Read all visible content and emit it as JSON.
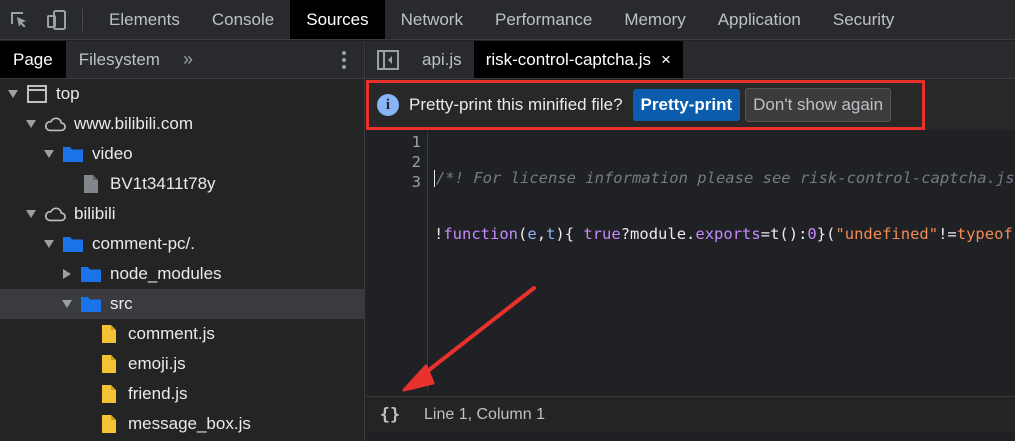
{
  "devtools": {
    "tabs": [
      "Elements",
      "Console",
      "Sources",
      "Network",
      "Performance",
      "Memory",
      "Application",
      "Security"
    ],
    "active_tab": "Sources"
  },
  "navigator": {
    "tabs": [
      "Page",
      "Filesystem"
    ],
    "active_tab": "Page",
    "more_label": "»",
    "tree": [
      {
        "label": "top",
        "depth": 0,
        "icon": "frame-icon",
        "expanded": true
      },
      {
        "label": "www.bilibili.com",
        "depth": 1,
        "icon": "cloud-icon",
        "expanded": true
      },
      {
        "label": "video",
        "depth": 2,
        "icon": "folder-icon",
        "expanded": true
      },
      {
        "label": "BV1t3411t78y",
        "depth": 3,
        "icon": "file-icon-gray",
        "expanded": null
      },
      {
        "label": "bilibili",
        "depth": 1,
        "icon": "cloud-icon",
        "expanded": true
      },
      {
        "label": "comment-pc/.",
        "depth": 2,
        "icon": "folder-icon",
        "expanded": true
      },
      {
        "label": "node_modules",
        "depth": 3,
        "icon": "folder-icon",
        "expanded": false
      },
      {
        "label": "src",
        "depth": 3,
        "icon": "folder-icon",
        "expanded": true,
        "selected": true
      },
      {
        "label": "comment.js",
        "depth": 4,
        "icon": "file-icon-yellow",
        "expanded": null
      },
      {
        "label": "emoji.js",
        "depth": 4,
        "icon": "file-icon-yellow",
        "expanded": null
      },
      {
        "label": "friend.js",
        "depth": 4,
        "icon": "file-icon-yellow",
        "expanded": null
      },
      {
        "label": "message_box.js",
        "depth": 4,
        "icon": "file-icon-yellow",
        "expanded": null
      }
    ]
  },
  "editor": {
    "file_tabs": [
      {
        "label": "api.js",
        "active": false
      },
      {
        "label": "risk-control-captcha.js",
        "active": true,
        "close": "×"
      }
    ],
    "infobar": {
      "message": "Pretty-print this minified file?",
      "primary_button": "Pretty-print",
      "secondary_button": "Don't show again"
    },
    "line_numbers": [
      "1",
      "2",
      "3"
    ],
    "code": {
      "line1": "/*! For license information please see risk-control-captcha.js.LICENSE.txt */",
      "line2_parts": [
        {
          "t": "!",
          "c": "c-plain"
        },
        {
          "t": "function",
          "c": "c-kw"
        },
        {
          "t": "(",
          "c": "c-plain"
        },
        {
          "t": "e",
          "c": "c-ident"
        },
        {
          "t": ",",
          "c": "c-plain"
        },
        {
          "t": "t",
          "c": "c-ident"
        },
        {
          "t": "){ ",
          "c": "c-plain"
        },
        {
          "t": "true",
          "c": "c-kw"
        },
        {
          "t": "?",
          "c": "c-plain"
        },
        {
          "t": "module",
          "c": "c-plain"
        },
        {
          "t": ".",
          "c": "c-plain"
        },
        {
          "t": "exports",
          "c": "c-kw"
        },
        {
          "t": "=",
          "c": "c-plain"
        },
        {
          "t": "t",
          "c": "c-plain"
        },
        {
          "t": "():",
          "c": "c-plain"
        },
        {
          "t": "0",
          "c": "c-kw"
        },
        {
          "t": "}(",
          "c": "c-plain"
        },
        {
          "t": "\"undefined\"",
          "c": "c-str"
        },
        {
          "t": "!=",
          "c": "c-plain"
        },
        {
          "t": "typeof",
          "c": "c-str"
        }
      ]
    },
    "status": {
      "pretty_print_toggle": "{}",
      "position": "Line 1, Column 1"
    }
  },
  "colors": {
    "annotation_red": "#e8312c",
    "accent_blue": "#0b5cad",
    "folder_blue": "#1a73e8",
    "file_yellow": "#f2c335"
  }
}
